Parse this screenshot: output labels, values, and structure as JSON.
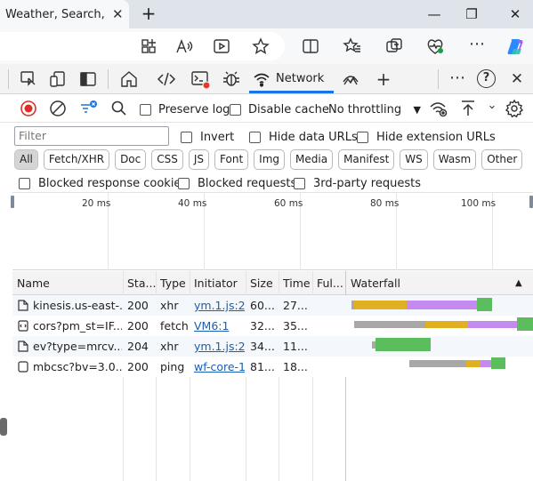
{
  "browser": {
    "tab_title": "Weather, Search, Po",
    "tab_close": "✕",
    "new_tab": "+",
    "window_controls": {
      "minimize": "—",
      "restore": "❐",
      "close": "✕"
    }
  },
  "devtools_tabs": {
    "network_label": "Network",
    "add_tab": "+",
    "more": "⋯",
    "help": "?",
    "close": "✕"
  },
  "network_toolbar": {
    "preserve_log": "Preserve log",
    "disable_cache": "Disable cache",
    "throttling": "No throttling",
    "more": "›"
  },
  "filters": {
    "filter_placeholder": "Filter",
    "invert": "Invert",
    "hide_data_urls": "Hide data URLs",
    "hide_extension_urls": "Hide extension URLs",
    "types": [
      "All",
      "Fetch/XHR",
      "Doc",
      "CSS",
      "JS",
      "Font",
      "Img",
      "Media",
      "Manifest",
      "WS",
      "Wasm",
      "Other"
    ],
    "selected_type": "All",
    "blocked_response_cookies": "Blocked response cookies",
    "blocked_requests": "Blocked requests",
    "third_party_requests": "3rd-party requests"
  },
  "overview": {
    "ticks": [
      "20 ms",
      "40 ms",
      "60 ms",
      "80 ms",
      "100 ms"
    ]
  },
  "table": {
    "columns": {
      "name": "Name",
      "status": "Sta...",
      "type": "Type",
      "initiator": "Initiator",
      "size": "Size",
      "time": "Time",
      "fulfilled": "Ful...",
      "waterfall": "Waterfall",
      "sort_indicator": "▲"
    },
    "rows": [
      {
        "name": "kinesis.us-east-...",
        "status": "200",
        "type": "xhr",
        "initiator": "ym.1.js:2",
        "size": "60...",
        "time": "27..."
      },
      {
        "name": "cors?pm_st=IF...",
        "status": "200",
        "type": "fetch",
        "initiator": "VM6:1",
        "size": "32...",
        "time": "35..."
      },
      {
        "name": "ev?type=mrcv...",
        "status": "204",
        "type": "xhr",
        "initiator": "ym.1.js:2",
        "size": "34...",
        "time": "11..."
      },
      {
        "name": "mbcsc?bv=3.0....",
        "status": "200",
        "type": "ping",
        "initiator": "wf-core-1.",
        "size": "81...",
        "time": "18..."
      }
    ]
  },
  "colors": {
    "queue": "#a8a8a8",
    "stalled": "#e0b020",
    "waiting": "#c58af0",
    "download": "#5cbd5c",
    "accent": "#1a73e8"
  }
}
